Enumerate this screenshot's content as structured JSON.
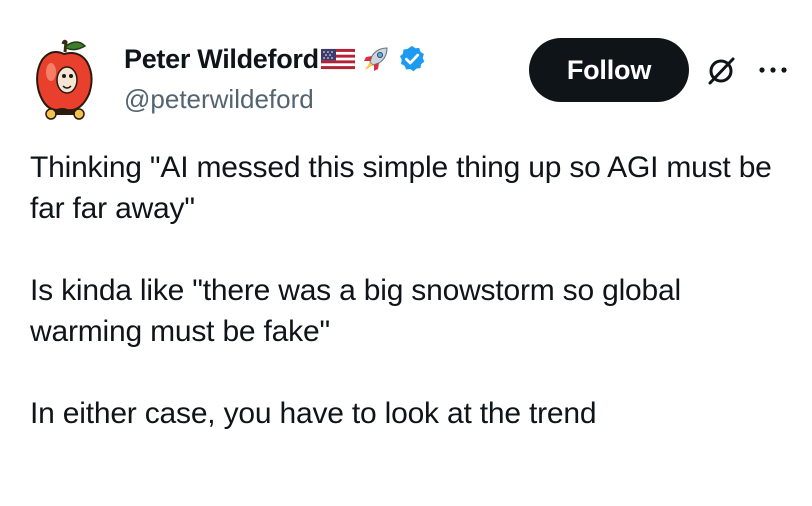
{
  "author": {
    "display_name": "Peter Wildeford",
    "handle": "@peterwildeford",
    "name_emojis": [
      "us-flag-emoji",
      "rocket-emoji"
    ],
    "verified": true,
    "verified_color": "#1d9bf0"
  },
  "actions": {
    "follow_label": "Follow",
    "grok_icon": "grok-icon",
    "more_icon": "more-horizontal-icon"
  },
  "tweet": {
    "paragraphs": [
      "Thinking \"AI messed this simple thing up so AGI must be far far away\"",
      "Is kinda like \"there was a big snowstorm so global warming must be fake\"",
      "In either case, you have to look at the trend"
    ]
  },
  "colors": {
    "text": "#0f1419",
    "secondary_text": "#536471",
    "follow_bg": "#0f1419",
    "follow_text": "#ffffff"
  }
}
